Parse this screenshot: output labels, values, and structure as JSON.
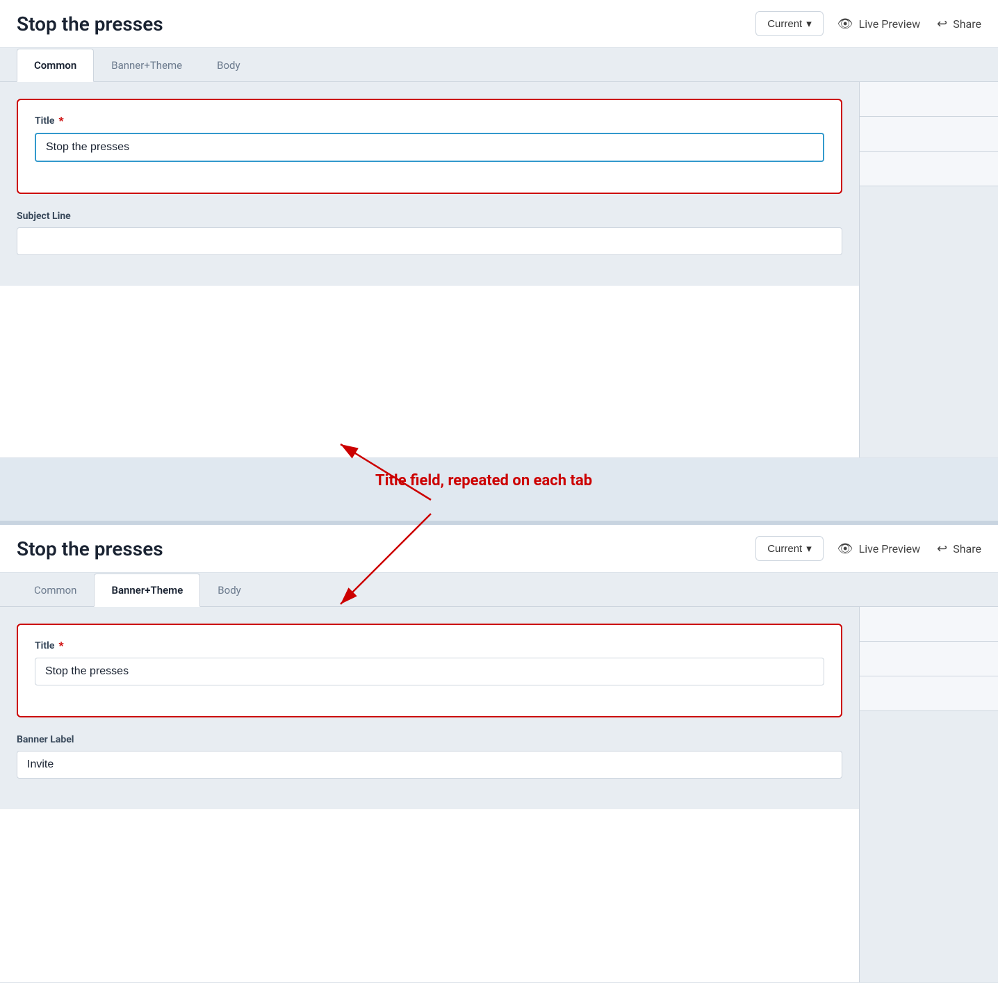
{
  "page": {
    "title": "Stop the presses"
  },
  "version_button": {
    "label": "Current",
    "chevron": "▾"
  },
  "header": {
    "live_preview": "Live Preview",
    "share": "Share"
  },
  "top_section": {
    "tabs": [
      {
        "id": "common",
        "label": "Common",
        "active": true
      },
      {
        "id": "banner-theme",
        "label": "Banner+Theme",
        "active": false
      },
      {
        "id": "body",
        "label": "Body",
        "active": false
      }
    ],
    "title_label": "Title",
    "title_required": "*",
    "title_value": "Stop the presses",
    "subject_line_label": "Subject Line",
    "subject_line_value": ""
  },
  "annotation": {
    "text": "Title field, repeated on each tab"
  },
  "bottom_section": {
    "tabs": [
      {
        "id": "common",
        "label": "Common",
        "active": false
      },
      {
        "id": "banner-theme",
        "label": "Banner+Theme",
        "active": true
      },
      {
        "id": "body",
        "label": "Body",
        "active": false
      }
    ],
    "title_label": "Title",
    "title_required": "*",
    "title_value": "Stop the presses",
    "banner_label": "Banner Label",
    "banner_value": "Invite"
  },
  "icons": {
    "eye": "👁",
    "share_arrow": "↪",
    "chevron_down": "∨"
  }
}
